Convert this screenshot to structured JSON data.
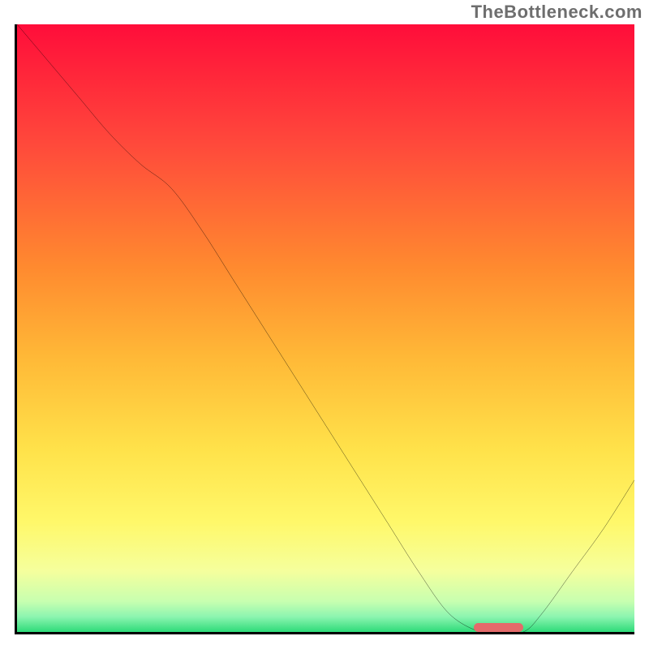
{
  "watermark": "TheBottleneck.com",
  "chart_data": {
    "type": "line",
    "title": "",
    "xlabel": "",
    "ylabel": "",
    "xlim": [
      0,
      100
    ],
    "ylim": [
      0,
      100
    ],
    "x": [
      0,
      5,
      10,
      15,
      20,
      25,
      30,
      35,
      40,
      45,
      50,
      55,
      60,
      65,
      70,
      75,
      78,
      82,
      85,
      90,
      95,
      100
    ],
    "values": [
      100,
      94,
      88,
      82,
      77,
      73,
      66,
      58,
      50,
      42,
      34,
      26,
      18,
      10,
      3,
      0,
      0,
      0,
      3,
      10,
      17,
      25
    ],
    "gradient_stops": [
      {
        "offset": 0.0,
        "color": "#ff0d3a"
      },
      {
        "offset": 0.2,
        "color": "#ff4a3b"
      },
      {
        "offset": 0.4,
        "color": "#ff8a2f"
      },
      {
        "offset": 0.55,
        "color": "#ffb937"
      },
      {
        "offset": 0.7,
        "color": "#ffe24a"
      },
      {
        "offset": 0.82,
        "color": "#fff86a"
      },
      {
        "offset": 0.9,
        "color": "#f5ff9d"
      },
      {
        "offset": 0.95,
        "color": "#c7ffb0"
      },
      {
        "offset": 0.975,
        "color": "#8cf5b0"
      },
      {
        "offset": 1.0,
        "color": "#2edb79"
      }
    ],
    "marker": {
      "x_start": 74,
      "x_end": 82,
      "y": 0.8,
      "color": "#e46a6a"
    }
  }
}
